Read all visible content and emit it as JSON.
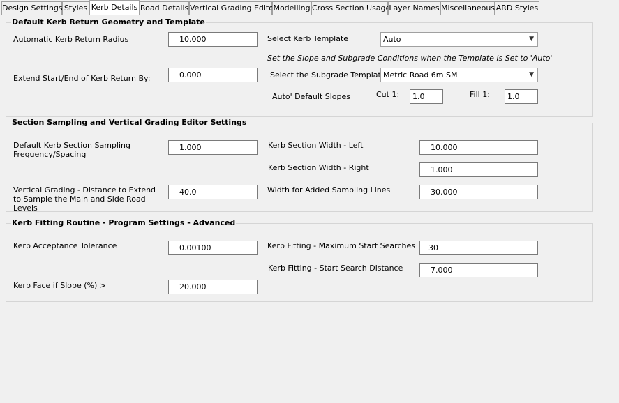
{
  "tabs": [
    "Design Settings",
    "Styles",
    "Kerb Details",
    "Road Details",
    "Vertical Grading Editor",
    "Modelling",
    "Cross Section Usage",
    "Layer Names",
    "Miscellaneous",
    "ARD Styles"
  ],
  "active_tab": "Kerb Details",
  "group1": {
    "title": "Default Kerb Return Geometry and Template",
    "radius_label": "Automatic Kerb Return Radius",
    "radius_value": "10.000",
    "extend_label": "Extend Start/End of Kerb Return By:",
    "extend_value": "0.000",
    "template_label": "Select Kerb Template",
    "template_value": "Auto",
    "note": "Set the Slope and Subgrade Conditions when the Template is Set to 'Auto'",
    "subgrade_label": "Select the Subgrade Template",
    "subgrade_value": "Metric Road 6m SM",
    "slopes_label": "'Auto' Default Slopes",
    "cut_label": "Cut 1:",
    "cut_value": "1.0",
    "fill_label": "Fill 1:",
    "fill_value": "1.0"
  },
  "group2": {
    "title": "Section Sampling and Vertical Grading Editor Settings",
    "sampling_label": "Default Kerb Section Sampling Frequency/Spacing",
    "sampling_value": "1.000",
    "vg_label": "Vertical Grading - Distance to Extend to Sample the Main and Side Road Levels",
    "vg_value": "40.0",
    "width_left_label": "Kerb Section Width - Left",
    "width_left_value": "10.000",
    "width_right_label": "Kerb Section Width - Right",
    "width_right_value": "1.000",
    "added_label": "Width for Added Sampling Lines",
    "added_value": "30.000"
  },
  "group3": {
    "title": "Kerb Fitting Routine - Program Settings - Advanced",
    "tolerance_label": "Kerb Acceptance Tolerance",
    "tolerance_value": "0.00100",
    "face_label": "Kerb Face if Slope (%) >",
    "face_value": "20.000",
    "max_label": "Kerb Fitting - Maximum Start Searches",
    "max_value": "30",
    "start_label": "Kerb Fitting - Start Search Distance",
    "start_value": "7.000"
  }
}
